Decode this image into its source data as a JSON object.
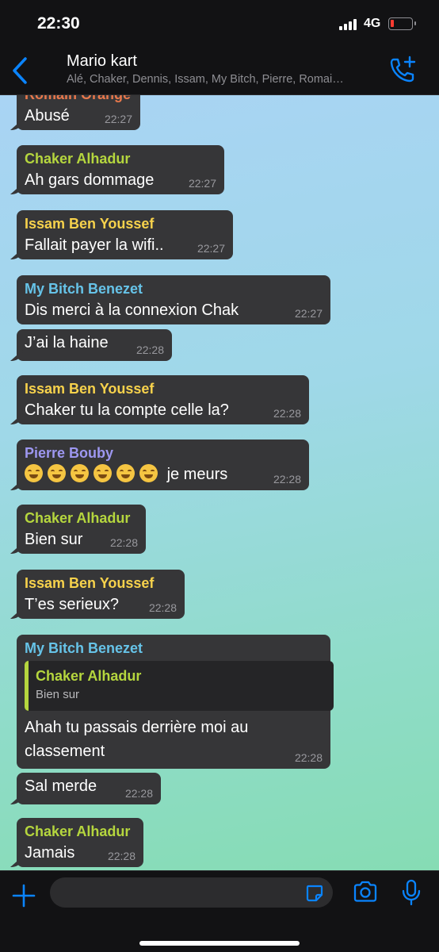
{
  "status_bar": {
    "time": "22:30",
    "network": "4G",
    "battery_color": "#ff3b30"
  },
  "header": {
    "title": "Mario kart",
    "members": "Alé, Chaker, Dennis, Issam, My Bitch, Pierre, Romai…"
  },
  "messages": [
    {
      "sender": "Romain Orange",
      "text": "Abusé",
      "time": "22:27"
    },
    {
      "sender": "Chaker Alhadur",
      "text": "Ah gars dommage",
      "time": "22:27"
    },
    {
      "sender": "Issam Ben Youssef",
      "text": "Fallait payer la wifi..",
      "time": "22:27"
    },
    {
      "sender": "My Bitch Benezet",
      "text": "Dis merci à la connexion Chak",
      "time": "22:27"
    },
    {
      "sender": "",
      "text": "J’ai la haine",
      "time": "22:28"
    },
    {
      "sender": "Issam Ben Youssef",
      "text": "Chaker tu la compte celle la?",
      "time": "22:28"
    },
    {
      "sender": "Pierre Bouby",
      "text": "je meurs",
      "time": "22:28",
      "emoji": "face-with-tears-of-joy x6"
    },
    {
      "sender": "Chaker Alhadur",
      "text": "Bien sur",
      "time": "22:28"
    },
    {
      "sender": "Issam Ben Youssef",
      "text": "T’es serieux?",
      "time": "22:28"
    },
    {
      "sender": "My Bitch Benezet",
      "reply": {
        "name": "Chaker Alhadur",
        "text": "Bien sur"
      },
      "text_line1": "Ahah tu passais derrière moi au",
      "text_line2": "classement",
      "time": "22:28"
    },
    {
      "sender": "",
      "text": "Sal merde",
      "time": "22:28"
    },
    {
      "sender": "Chaker Alhadur",
      "text": "Jamais",
      "time": "22:28"
    }
  ],
  "composer": {
    "value": "",
    "placeholder": ""
  },
  "colors": {
    "accent": "#0a84ff",
    "sender_orange": "#e8784c",
    "sender_green": "#b5d63e",
    "sender_yellow": "#f7d24c",
    "sender_blue": "#66c3e8",
    "sender_purple": "#9d97f0"
  }
}
